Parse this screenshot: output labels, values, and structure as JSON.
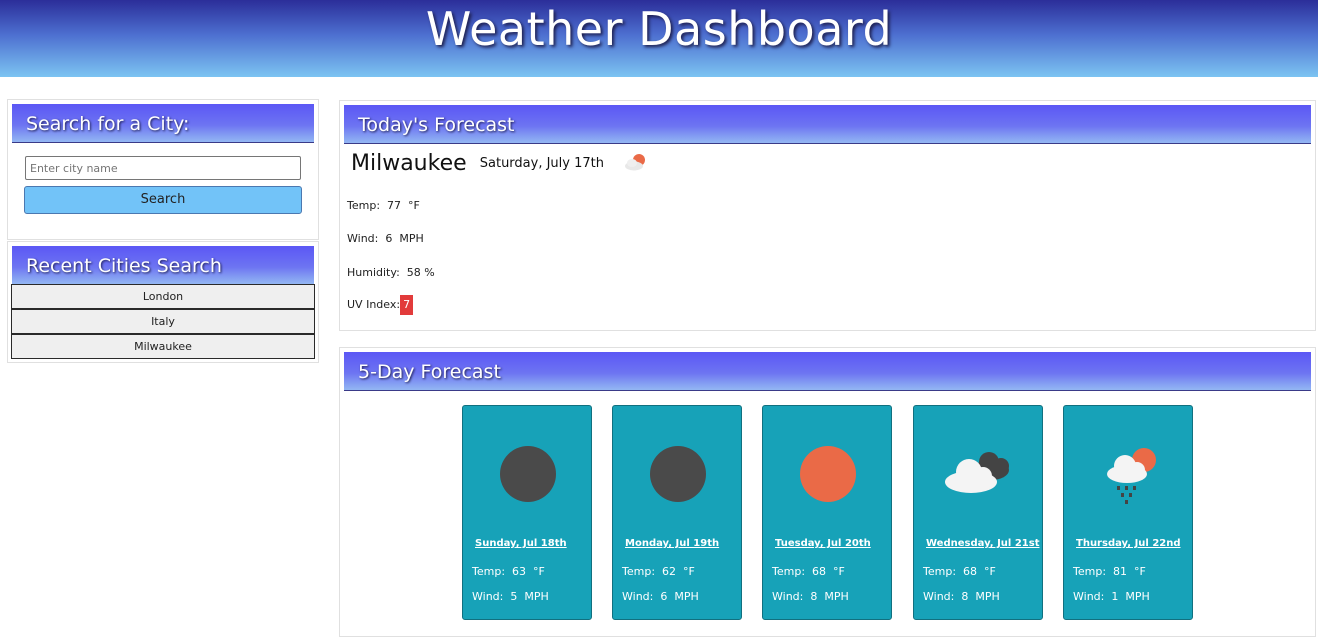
{
  "header": {
    "title": "Weather Dashboard"
  },
  "search": {
    "heading": "Search for a City:",
    "input_placeholder": "Enter city name",
    "input_value": "",
    "button_label": "Search"
  },
  "recent": {
    "heading": "Recent Cities Search",
    "cities": [
      "London",
      "Italy",
      "Milwaukee"
    ]
  },
  "today": {
    "heading": "Today's Forecast",
    "city": "Milwaukee",
    "date": "Saturday, July 17th",
    "icon": "partly-sunny-icon",
    "temp_label": "Temp:",
    "temp": "77",
    "temp_unit": "°F",
    "wind_label": "Wind:",
    "wind": "6",
    "wind_unit": "MPH",
    "humidity_label": "Humidity:",
    "humidity": "58",
    "humidity_unit": "%",
    "uv_label": "UV Index:",
    "uv": "7",
    "uv_color": "#e23b3b"
  },
  "five_day": {
    "heading": "5-Day Forecast",
    "days": [
      {
        "date": "Sunday, Jul 18th",
        "icon": "dark-circle-icon",
        "temp_label": "Temp:",
        "temp": "63",
        "temp_unit": "°F",
        "wind_label": "Wind:",
        "wind": "5",
        "wind_unit": "MPH"
      },
      {
        "date": "Monday, Jul 19th",
        "icon": "dark-circle-icon",
        "temp_label": "Temp:",
        "temp": "62",
        "temp_unit": "°F",
        "wind_label": "Wind:",
        "wind": "6",
        "wind_unit": "MPH"
      },
      {
        "date": "Tuesday, Jul 20th",
        "icon": "sun-icon",
        "temp_label": "Temp:",
        "temp": "68",
        "temp_unit": "°F",
        "wind_label": "Wind:",
        "wind": "8",
        "wind_unit": "MPH"
      },
      {
        "date": "Wednesday, Jul 21st",
        "icon": "cloudy-icon",
        "temp_label": "Temp:",
        "temp": "68",
        "temp_unit": "°F",
        "wind_label": "Wind:",
        "wind": "8",
        "wind_unit": "MPH"
      },
      {
        "date": "Thursday, Jul 22nd",
        "icon": "rain-sun-icon",
        "temp_label": "Temp:",
        "temp": "81",
        "temp_unit": "°F",
        "wind_label": "Wind:",
        "wind": "1",
        "wind_unit": "MPH"
      }
    ]
  },
  "colors": {
    "card": "#17a2b8",
    "search_button": "#72c3f8",
    "sun": "#ea6a47",
    "dark_circle": "#4a4a4a"
  }
}
